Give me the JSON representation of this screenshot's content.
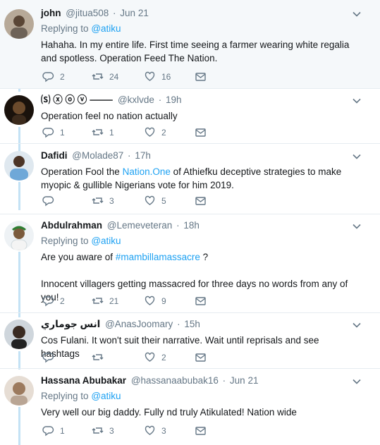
{
  "tweets": [
    {
      "name": "john",
      "handle": "@jitua508",
      "time": "Jun 21",
      "replying_prefix": "Replying to",
      "replying_to": "@atiku",
      "text": "Hahaha. In my entire life. First time seeing a farmer wearing white regalia  and spotless. Operation Feed The Nation.",
      "replies": "2",
      "retweets": "24",
      "likes": "16",
      "avatar_color": "#8a7b6b"
    },
    {
      "name": "⒮ ⓧ ⓞ ⓥ ⸻",
      "handle": "@kxlvde",
      "time": "19h",
      "text": "Operation feel no nation actually",
      "replies": "1",
      "retweets": "1",
      "likes": "2",
      "avatar_color": "#2d1e12"
    },
    {
      "name": "Dafidi",
      "handle": "@Molade87",
      "time": "17h",
      "text_pre": "Operation Fool the ",
      "text_link": "Nation.One",
      "text_post": " of Athiefku deceptive strategies to make myopic & gullible Nigerians vote for him 2019.",
      "replies": "",
      "retweets": "3",
      "likes": "5",
      "avatar_color": "#6fa8d8"
    },
    {
      "name": "Abdulrahman",
      "handle": "@Lemeveteran",
      "time": "18h",
      "replying_prefix": "Replying to",
      "replying_to": "@atiku",
      "text_pre": "Are you aware of ",
      "text_link": "#mambillamassacre",
      "text_post": " ?",
      "text2": "Innocent villagers getting massacred for three days no words from any of you!",
      "replies": "2",
      "retweets": "21",
      "likes": "9",
      "avatar_color": "#e8eef3"
    },
    {
      "name": "انس جوماري",
      "handle": "@AnasJoomary",
      "time": "15h",
      "text": "Cos Fulani. It won't suit their narrative. Wait until reprisals and see hashtags",
      "replies": "",
      "retweets": "",
      "likes": "2",
      "avatar_color": "#3a2b22"
    },
    {
      "name": "Hassana Abubakar",
      "handle": "@hassanaabubak16",
      "time": "Jun 21",
      "replying_prefix": "Replying to",
      "replying_to": "@atiku",
      "text": "Very well our big daddy. Fully nd truly Atikulated! Nation wide",
      "replies": "1",
      "retweets": "3",
      "likes": "3",
      "avatar_color": "#c9b7a8"
    }
  ],
  "separator": "·",
  "colors": {
    "link": "#1da1f2",
    "muted": "#657786",
    "thread": "#c4e2f5",
    "highlight_bg": "#f5f8fa"
  }
}
